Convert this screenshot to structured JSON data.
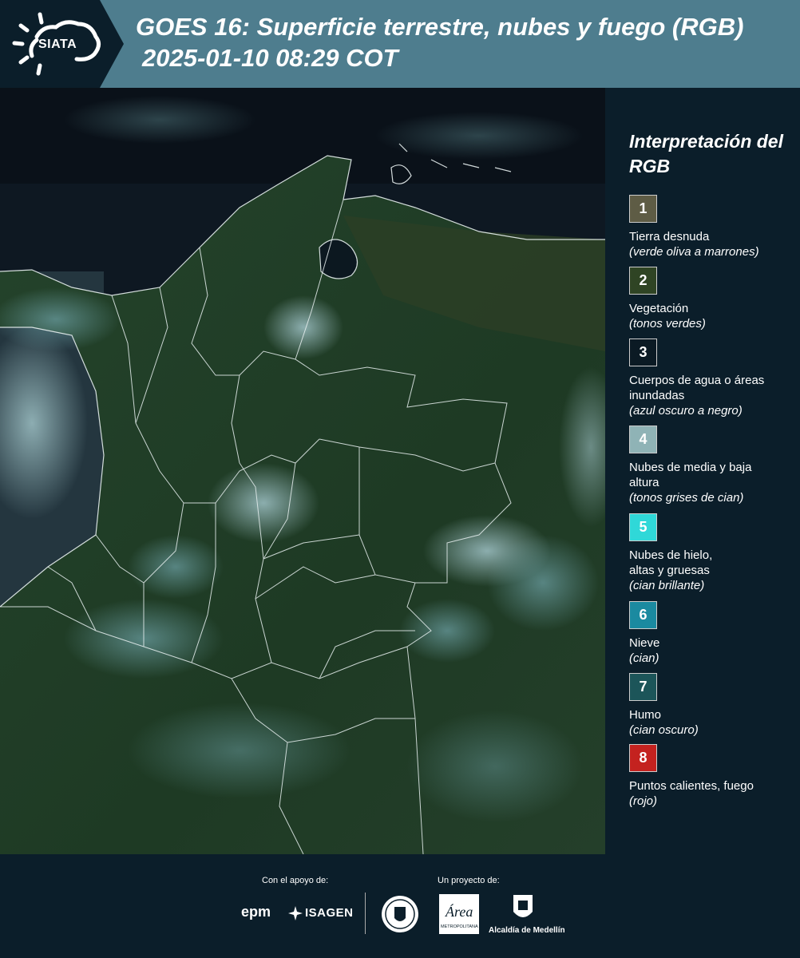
{
  "header": {
    "logo_text": "SIATA",
    "title": "GOES 16: Superficie terrestre, nubes y fuego (RGB)",
    "subtitle": "2025-01-10 08:29 COT"
  },
  "legend": {
    "title": "Interpretación del RGB",
    "items": [
      {
        "number": "1",
        "label": "Tierra desnuda",
        "sub": "(verde oliva a marrones)",
        "color": "#5e5c45"
      },
      {
        "number": "2",
        "label": "Vegetación",
        "sub": "(tonos verdes)",
        "color": "#2f4424"
      },
      {
        "number": "3",
        "label": "Cuerpos de agua o áreas inundadas",
        "sub": "(azul oscuro a negro)",
        "color": "#0b1a24"
      },
      {
        "number": "4",
        "label": "Nubes de media y baja altura",
        "sub": "(tonos grises de cian)",
        "color": "#8fb3b6"
      },
      {
        "number": "5",
        "label": "Nubes de hielo, altas y gruesas",
        "sub": "(cian brillante)",
        "color": "#2fd8d8"
      },
      {
        "number": "6",
        "label": "Nieve",
        "sub": "(cian)",
        "color": "#1b8aa0"
      },
      {
        "number": "7",
        "label": "Humo",
        "sub": "(cian oscuro)",
        "color": "#1c5559"
      },
      {
        "number": "8",
        "label": "Puntos calientes, fuego",
        "sub": "(rojo)",
        "color": "#c4221f"
      }
    ]
  },
  "footer": {
    "support_label": "Con el apoyo de:",
    "project_label": "Un proyecto de:",
    "sponsor_1": "epm",
    "sponsor_2": "ISAGEN",
    "partner_1": "METROPOLITANA",
    "partner_2": "Alcaldía de Medellín"
  },
  "colors": {
    "header_bg": "#4e7d8e",
    "panel_bg": "#0b1e2a",
    "ocean": "#0d1620",
    "land": "#1f3a26"
  }
}
